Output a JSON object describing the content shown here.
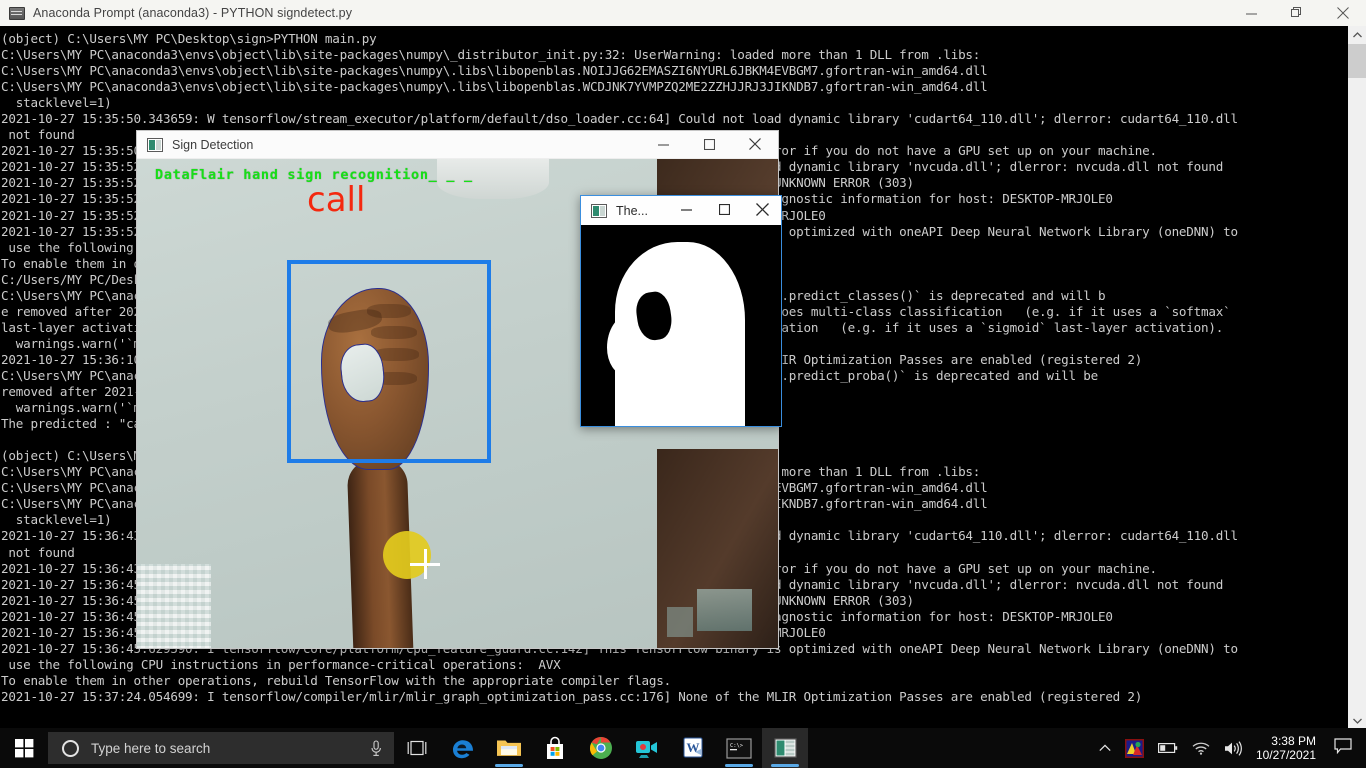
{
  "cmd_window": {
    "title": "Anaconda Prompt (anaconda3) - PYTHON  signdetect.py",
    "icon": "console-icon",
    "minimize": "─",
    "restore": "❐",
    "close": "✕",
    "console_lines": [
      "(object) C:\\Users\\MY PC\\Desktop\\sign>PYTHON main.py",
      "C:\\Users\\MY PC\\anaconda3\\envs\\object\\lib\\site-packages\\numpy\\_distributor_init.py:32: UserWarning: loaded more than 1 DLL from .libs:",
      "C:\\Users\\MY PC\\anaconda3\\envs\\object\\lib\\site-packages\\numpy\\.libs\\libopenblas.NOIJJG62EMASZI6NYURL6JBKM4EVBGM7.gfortran-win_amd64.dll",
      "C:\\Users\\MY PC\\anaconda3\\envs\\object\\lib\\site-packages\\numpy\\.libs\\libopenblas.WCDJNK7YVMPZQ2ME2ZZHJJRJ3JIKNDB7.gfortran-win_amd64.dll",
      "  stacklevel=1)",
      "2021-10-27 15:35:50.343659: W tensorflow/stream_executor/platform/default/dso_loader.cc:64] Could not load dynamic library 'cudart64_110.dll'; dlerror: cudart64_110.dll",
      " not found",
      "2021-10-27 15:35:50.343707: I tensorflow/stream_executor/cuda/cudart_stub.cc:29] Ignore above cudart dlerror if you do not have a GPU set up on your machine.",
      "2021-10-27 15:35:52.216733: W tensorflow/stream_executor/platform/default/dso_loader.cc:64] Could not load dynamic library 'nvcuda.dll'; dlerror: nvcuda.dll not found",
      "2021-10-27 15:35:52.216925: W tensorflow/stream_executor/cuda/cuda_driver.cc:269] failed call to cuInit: UNKNOWN ERROR (303)",
      "2021-10-27 15:35:52.222176: I tensorflow/stream_executor/cuda/cuda_diagnostics.cc:169] retrieving CUDA diagnostic information for host: DESKTOP-MRJOLE0",
      "2021-10-27 15:35:52.222450: I tensorflow/stream_executor/cuda/cuda_diagnostics.cc:176] hostname: DESKTOP-MRJOLE0",
      "2021-10-27 15:35:52.229518: I tensorflow/core/platform/cpu_feature_guard.cc:142] This TensorFlow binary is optimized with oneAPI Deep Neural Network Library (oneDNN) to",
      " use the following CPU instructions in performance-critical operations:  AVX",
      "To enable them in other operations, rebuild TensorFlow with the appropriate compiler flags.",
      "C:/Users/MY PC/Desktop/sign/cropped.jpeg",
      "C:\\Users\\MY PC\\anaconda3\\envs\\object\\lib\\site-packages\\keras\\engine\\sequential.py:455: UserWarning: `model.predict_classes()` is deprecated and will b",
      "e removed after 2021-01-01. Please use instead:* `np.argmax(model.predict(x), axis=-1)`,   if your model does multi-class classification   (e.g. if it uses a `softmax`",
      "last-layer activation).* `(model.predict(x) > 0.5).astype(\"int32\")`,   if your model does binary classification   (e.g. if it uses a `sigmoid` last-layer activation).",
      "  warnings.warn('`model.predict_classes()` is deprecated and '",
      "2021-10-27 15:36:10.330118: I tensorflow/compiler/mlir/mlir_graph_optimization_pass.cc:176] None of the MLIR Optimization Passes are enabled (registered 2)",
      "C:\\Users\\MY PC\\anaconda3\\envs\\object\\lib\\site-packages\\keras\\engine\\sequential.py:430: UserWarning: `model.predict_proba()` is deprecated and will be",
      "removed after 2021-01-01. Please use `model.predict()` instead.",
      "  warnings.warn('`model.predict_proba()` is deprecated and '",
      "The predicted : \"call\"",
      "",
      "(object) C:\\Users\\MY PC\\Desktop\\sign>PYTHON signdetect.py",
      "C:\\Users\\MY PC\\anaconda3\\envs\\object\\lib\\site-packages\\numpy\\_distributor_init.py:32: UserWarning: loaded more than 1 DLL from .libs:",
      "C:\\Users\\MY PC\\anaconda3\\envs\\object\\lib\\site-packages\\numpy\\.libs\\libopenblas.NOIJJG62EMASZI6NYURL6JBKM4EVBGM7.gfortran-win_amd64.dll",
      "C:\\Users\\MY PC\\anaconda3\\envs\\object\\lib\\site-packages\\numpy\\.libs\\libopenblas.WCDJNK7YVMPZQ2ME2ZZHJJRJ3JIKNDB7.gfortran-win_amd64.dll",
      "  stacklevel=1)",
      "2021-10-27 15:36:43.100418: W tensorflow/stream_executor/platform/default/dso_loader.cc:64] Could not load dynamic library 'cudart64_110.dll'; dlerror: cudart64_110.dll",
      " not found",
      "2021-10-27 15:36:43.100521: I tensorflow/stream_executor/cuda/cudart_stub.cc:29] Ignore above cudart dlerror if you do not have a GPU set up on your machine.",
      "2021-10-27 15:36:45.600312: W tensorflow/stream_executor/platform/default/dso_loader.cc:64] Could not load dynamic library 'nvcuda.dll'; dlerror: nvcuda.dll not found",
      "2021-10-27 15:36:45.600602: W tensorflow/stream_executor/cuda/cuda_driver.cc:269] failed call to cuInit: UNKNOWN ERROR (303)",
      "2021-10-27 15:36:45.623915: I tensorflow/stream_executor/cuda/cuda_diagnostics.cc:169] retrieving CUDA diagnostic information for host: DESKTOP-MRJOLE0",
      "2021-10-27 15:36:45.624250: I tensorflow/stream_executor/cuda/cuda_diagnostics.cc:176] hostname: DESKTOP-MRJOLE0",
      "2021-10-27 15:36:45.629590: I tensorflow/core/platform/cpu_feature_guard.cc:142] This TensorFlow binary is optimized with oneAPI Deep Neural Network Library (oneDNN) to",
      " use the following CPU instructions in performance-critical operations:  AVX",
      "To enable them in other operations, rebuild TensorFlow with the appropriate compiler flags.",
      "2021-10-27 15:37:24.054699: I tensorflow/compiler/mlir/mlir_graph_optimization_pass.cc:176] None of the MLIR Optimization Passes are enabled (registered 2)"
    ]
  },
  "sign_window": {
    "title": "Sign Detection",
    "icon": "opencv-window-icon",
    "minimize": "─",
    "maximize": "☐",
    "close": "✕",
    "overlay_label": "DataFlair hand sign recognition_ _ _",
    "overlay_label_color": "#16e016",
    "prediction": "call",
    "prediction_color": "#f4280f",
    "bbox_color": "#1e7ce8",
    "contour_color": "#2b2f8e"
  },
  "thresh_window": {
    "title": "The...",
    "icon": "opencv-window-icon",
    "minimize": "─",
    "maximize": "☐",
    "close": "✕",
    "border_color": "#3a8ede"
  },
  "taskbar": {
    "start_label": "Start",
    "search_placeholder": "Type here to search",
    "cortana_icon": "cortana-circle-icon",
    "mic_icon": "microphone-icon",
    "taskview_icon": "task-view-icon",
    "apps": [
      {
        "name": "microsoft-edge",
        "label": "Microsoft Edge",
        "glyph": "e",
        "color": "#1a7fd4",
        "running": false
      },
      {
        "name": "file-explorer",
        "label": "File Explorer",
        "glyph": "",
        "color": "#f5c453",
        "running": true
      },
      {
        "name": "microsoft-store",
        "label": "Microsoft Store",
        "glyph": "",
        "color": "#ffffff",
        "running": false
      },
      {
        "name": "google-chrome",
        "label": "Google Chrome",
        "glyph": "",
        "color": "#4285f4",
        "running": false
      },
      {
        "name": "camera-recorder",
        "label": "Camera",
        "glyph": "",
        "color": "#24c6d8",
        "running": false
      },
      {
        "name": "microsoft-word",
        "label": "Word",
        "glyph": "W",
        "color": "#2b579a",
        "running": false
      },
      {
        "name": "command-prompt",
        "label": "Anaconda Prompt",
        "glyph": "C:\\>",
        "color": "#111111",
        "running": true
      },
      {
        "name": "photo-viewer",
        "label": "Sign Detection",
        "glyph": "",
        "color": "#2e8b6f",
        "running": true
      }
    ],
    "tray": {
      "chevron": "∧",
      "hidden_icons_label": "Show hidden icons",
      "app_icon": "colorful-app-icon",
      "battery_icon": "battery-icon",
      "network_icon": "wifi-icon",
      "volume_icon": "speaker-icon",
      "time": "3:38 PM",
      "date": "10/27/2021",
      "action_center_icon": "action-center-icon"
    }
  }
}
